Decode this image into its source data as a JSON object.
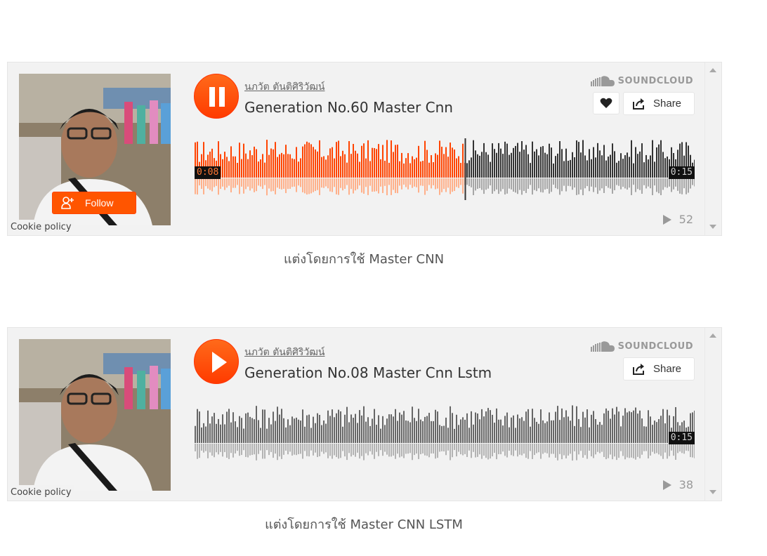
{
  "players": [
    {
      "state": "playing",
      "username": "นภวัต ตันติศิริวัฒน์",
      "track_title": "Generation No.60 Master Cnn",
      "brand": "SOUNDCLOUD",
      "follow_label": "Follow",
      "share_label": "Share",
      "show_like": true,
      "cookie_label": "Cookie policy",
      "time_current": "0:08",
      "time_total": "0:15",
      "progress": 0.54,
      "play_count": "52",
      "caption": "แต่งโดยการใช้ Master CNN",
      "colors": {
        "played": "#ff4400",
        "played_reflection": "#ffb08a",
        "unplayed": "#333333",
        "unplayed_reflection": "#a6a6a6"
      }
    },
    {
      "state": "paused",
      "username": "นภวัต ตันติศิริวัฒน์",
      "track_title": "Generation No.08 Master Cnn Lstm",
      "brand": "SOUNDCLOUD",
      "follow_label": "",
      "share_label": "Share",
      "show_like": false,
      "cookie_label": "Cookie policy",
      "time_current": "",
      "time_total": "0:15",
      "progress": 0,
      "play_count": "38",
      "caption": "แต่งโดยการใช้ Master CNN LSTM",
      "colors": {
        "played": "#ff4400",
        "played_reflection": "#ffb08a",
        "unplayed": "#666666",
        "unplayed_reflection": "#b3b3b3"
      }
    }
  ],
  "colors": {
    "accent": "#ff5500",
    "background": "#f2f2f2"
  },
  "icons": [
    "pause-icon",
    "play-icon",
    "soundcloud-cloud-icon",
    "heart-icon",
    "share-icon",
    "follow-user-icon",
    "play-count-icon",
    "scroll-up-icon",
    "scroll-down-icon"
  ]
}
